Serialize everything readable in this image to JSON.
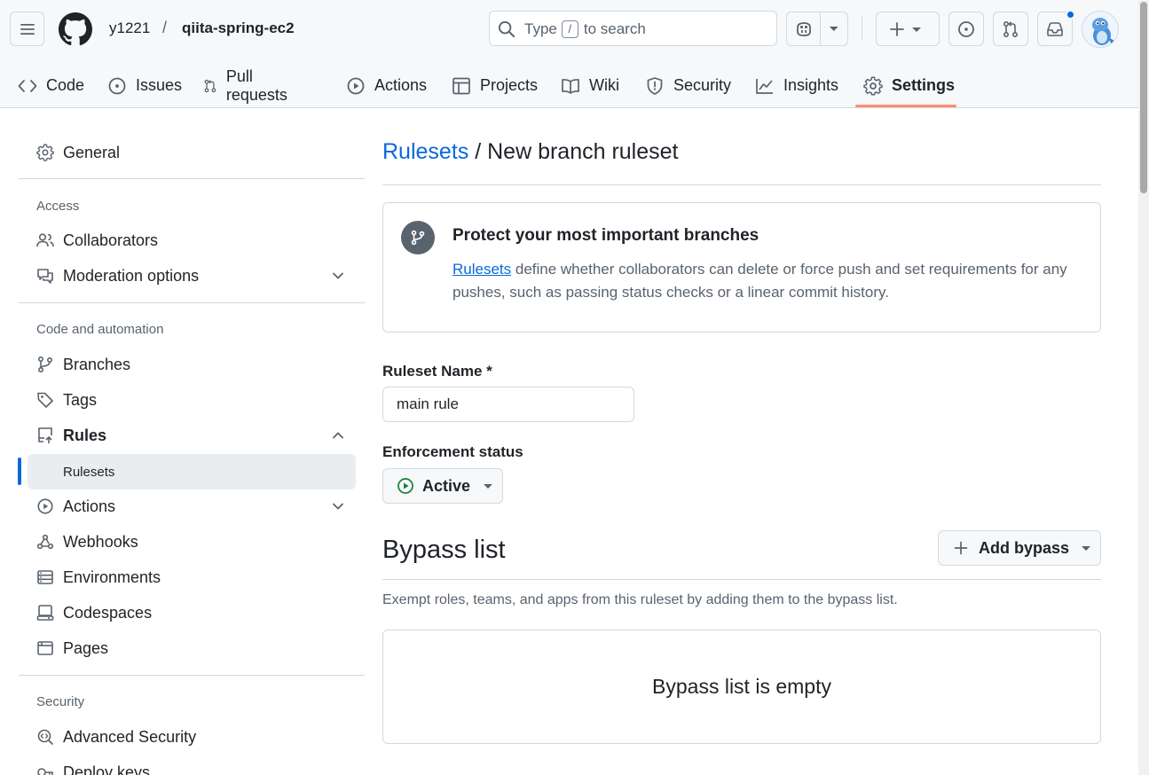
{
  "header": {
    "owner": "y1221",
    "separator": "/",
    "repo": "qiita-spring-ec2",
    "search": {
      "prefix": "Type",
      "key": "/",
      "suffix": "to search"
    }
  },
  "tabs": [
    {
      "label": "Code",
      "icon": "code-icon"
    },
    {
      "label": "Issues",
      "icon": "issue-opened-icon"
    },
    {
      "label": "Pull requests",
      "icon": "git-pull-request-icon"
    },
    {
      "label": "Actions",
      "icon": "play-icon"
    },
    {
      "label": "Projects",
      "icon": "table-icon"
    },
    {
      "label": "Wiki",
      "icon": "book-icon"
    },
    {
      "label": "Security",
      "icon": "shield-icon"
    },
    {
      "label": "Insights",
      "icon": "graph-icon"
    },
    {
      "label": "Settings",
      "icon": "gear-icon",
      "active": true
    }
  ],
  "sidebar": {
    "general": "General",
    "access_heading": "Access",
    "collaborators": "Collaborators",
    "moderation": "Moderation options",
    "code_heading": "Code and automation",
    "branches": "Branches",
    "tags": "Tags",
    "rules": "Rules",
    "rulesets": "Rulesets",
    "actions": "Actions",
    "webhooks": "Webhooks",
    "environments": "Environments",
    "codespaces": "Codespaces",
    "pages": "Pages",
    "security_heading": "Security",
    "advanced_security": "Advanced Security",
    "deploy_keys": "Deploy keys"
  },
  "main": {
    "breadcrumb_link": "Rulesets",
    "breadcrumb_sep": " / ",
    "page_title": "New branch ruleset",
    "info": {
      "title": "Protect your most important branches",
      "link": "Rulesets",
      "text": " define whether collaborators can delete or force push and set requirements for any pushes, such as passing status checks or a linear commit history."
    },
    "name_label": "Ruleset Name *",
    "name_value": "main rule",
    "enforcement_label": "Enforcement status",
    "enforcement_value": "Active",
    "bypass_title": "Bypass list",
    "add_bypass": "Add bypass",
    "bypass_desc": "Exempt roles, teams, and apps from this ruleset by adding them to the bypass list.",
    "bypass_empty": "Bypass list is empty"
  },
  "colors": {
    "accent": "#0969da",
    "tab_underline": "#fd8c73",
    "active_green": "#1a7f37",
    "notification": "#0969da"
  }
}
